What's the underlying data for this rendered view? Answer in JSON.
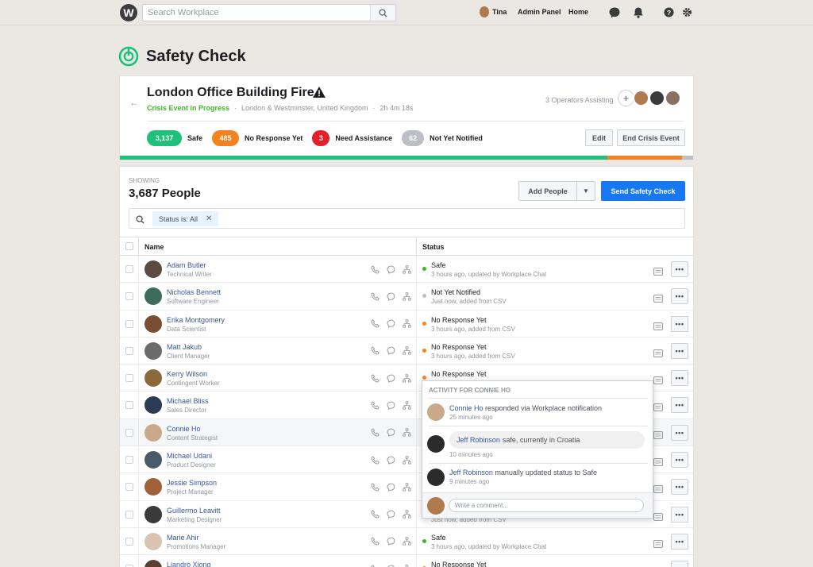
{
  "topbar": {
    "logo_letter": "W",
    "search_placeholder": "Search Workplace",
    "user_name": "Tina",
    "admin_panel": "Admin Panel",
    "home": "Home"
  },
  "page": {
    "title": "Safety Check"
  },
  "crisis": {
    "title": "London Office Building Fire",
    "status": "Crisis Event in Progress",
    "location": "London & Westminster, United Kingdom",
    "duration": "2h 4m 18s",
    "operators_text": "3 Operators Assisting",
    "counts": [
      {
        "value": "3,137",
        "label": "Safe",
        "color": "#1fc07a"
      },
      {
        "value": "485",
        "label": "No Response Yet",
        "color": "#f5821f"
      },
      {
        "value": "3",
        "label": "Need Assistance",
        "color": "#e4212a"
      },
      {
        "value": "62",
        "label": "Not Yet Notified",
        "color": "#bcc0c4"
      }
    ],
    "edit_label": "Edit",
    "end_label": "End Crisis Event",
    "progress": [
      {
        "fraction": 0.85,
        "color": "#1fc07a"
      },
      {
        "fraction": 0.13,
        "color": "#f5821f"
      },
      {
        "fraction": 0.02,
        "color": "#bcc0c4"
      }
    ]
  },
  "people": {
    "showing_label": "Showing",
    "count": "3,687 People",
    "add_people_label": "Add People",
    "send_label": "Send Safety Check",
    "filter_chip": "Status is: All",
    "col_name": "Name",
    "col_status": "Status",
    "rows": [
      {
        "name": "Adam Butler",
        "title": "Technical Writer",
        "status": "Safe",
        "detail": "3 hours ago, updated by Workplace Chat",
        "dot": "#42b72a",
        "av": "#5b4a3f"
      },
      {
        "name": "Nicholas Bennett",
        "title": "Software Engineer",
        "status": "Not Yet Notified",
        "detail": "Just now, added from CSV",
        "dot": "#bcc0c4",
        "av": "#3f6b5c"
      },
      {
        "name": "Erika Montgomery",
        "title": "Data Scientist",
        "status": "No Response Yet",
        "detail": "3 hours ago, added from CSV",
        "dot": "#f5821f",
        "av": "#7a4e30"
      },
      {
        "name": "Matt Jakub",
        "title": "Client Manager",
        "status": "No Response Yet",
        "detail": "3 hours ago, added from CSV",
        "dot": "#f5821f",
        "av": "#6b6b6b"
      },
      {
        "name": "Kerry Wilson",
        "title": "Contingent Worker",
        "status": "No Response Yet",
        "detail": "",
        "dot": "#f5821f",
        "av": "#8a6a3a"
      },
      {
        "name": "Michael Bliss",
        "title": "Sales Director",
        "status": "",
        "detail": "",
        "dot": "",
        "av": "#2b3a55"
      },
      {
        "name": "Connie Ho",
        "title": "Content Strategist",
        "status": "",
        "detail": "",
        "dot": "",
        "av": "#c9a98a"
      },
      {
        "name": "Michael Udani",
        "title": "Product Designer",
        "status": "",
        "detail": "",
        "dot": "",
        "av": "#4a5a6a"
      },
      {
        "name": "Jessie Simpson",
        "title": "Project Manager",
        "status": "",
        "detail": "",
        "dot": "",
        "av": "#a0603a"
      },
      {
        "name": "Guillermo Leavitt",
        "title": "Marketing Designer",
        "status": "",
        "detail": "Just now, added from CSV",
        "dot": "",
        "av": "#3a3a3a"
      },
      {
        "name": "Marie Ahir",
        "title": "Promotions Manager",
        "status": "Safe",
        "detail": "3 hours ago, updated by Workplace Chat",
        "dot": "#42b72a",
        "av": "#d8c4b0"
      },
      {
        "name": "Liandro Xiong",
        "title": "",
        "status": "No Response Yet",
        "detail": "",
        "dot": "#f5821f",
        "av": "#5a4030"
      }
    ]
  },
  "activity": {
    "header": "Activity for Connie Ho",
    "items": [
      {
        "who": "Connie Ho",
        "text": "responded via Workplace notification",
        "time": "25 minutes ago"
      },
      {
        "who": "Jeff Robinson",
        "text": "safe, currently in Croatia",
        "time": "10 minutes ago"
      },
      {
        "who": "Jeff Robinson",
        "text": "manually updated status to Safe",
        "time": "9 minutes ago"
      }
    ],
    "comment_placeholder": "Write a comment..."
  }
}
